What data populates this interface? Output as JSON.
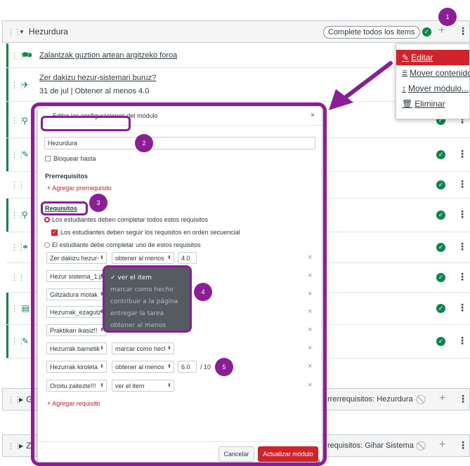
{
  "module": {
    "title": "Hezurdura",
    "completion_badge": "Complete todos los items",
    "items": [
      {
        "title": "Zalantzak guztion artean argitzeko foroa"
      },
      {
        "title": "Zer dakizu hezur-sistemari buruz?",
        "meta": "31 de jul | Obtener al menos 4.0"
      }
    ]
  },
  "context_menu": {
    "items": [
      {
        "label": "Editar",
        "icon": "pencil-icon"
      },
      {
        "label": "Mover contenido",
        "icon": "list-icon"
      },
      {
        "label": "Mover módulo...",
        "icon": "updown-arrow-icon"
      },
      {
        "label": "Eliminar",
        "icon": "trash-icon"
      }
    ]
  },
  "lower_modules": [
    {
      "prefix": "G",
      "prereq": "rrerrequisitos: Hezurdura"
    },
    {
      "prefix": "Z",
      "prereq": "requisitos: Gihar Sistema"
    }
  ],
  "modal": {
    "title": "Editar las configuraciones del módulo",
    "close_label": "×",
    "name_value": "Hezurdura",
    "lock_until_label": "Bloquear hasta",
    "prereq_heading": "Prerrequisitos",
    "add_prereq": "+ Agregar prerrequisito",
    "req_heading": "Requisitos",
    "radio_all": "Los estudiantes deben completar todos estos requisitos",
    "checkbox_sequential": "Los estudiantes deben seguir los requisitos en orden secuencial",
    "radio_one": "El estudiante debe completar uno de estos requisitos",
    "requirements": [
      {
        "item": "Zer dakizu hezur-",
        "type": "obtener al menos",
        "score": "4.0"
      },
      {
        "item": "Hezur sistema_1.p",
        "type": "",
        "score": ""
      },
      {
        "item": "Giltzadura motak",
        "type": "",
        "score": ""
      },
      {
        "item": "Hezurrak_ezagutz",
        "type": "",
        "score": ""
      },
      {
        "item": "Praktikan ikasiz!!",
        "type": "",
        "score": ""
      },
      {
        "item": "Hezurrak barnetik",
        "type": "marcar como hecl",
        "score": ""
      },
      {
        "item": "Hezurrak kiroleta",
        "type": "obtener al menos",
        "score": "6.0",
        "out_of": "/ 10"
      },
      {
        "item": "Oroitu zaitezte!!!",
        "type": "ver el item",
        "score": ""
      }
    ],
    "add_requirement": "+ Agregar requisito",
    "cancel_label": "Cancelar",
    "update_label": "Actualizar módulo",
    "row_remove": "×"
  },
  "dropdown_options": [
    {
      "label": "✓ ver el item",
      "selected": true
    },
    {
      "label": "marcar como hecho",
      "selected": false
    },
    {
      "label": "contribuir a la página",
      "selected": false
    },
    {
      "label": "entregar la tarea",
      "selected": false
    },
    {
      "label": "obtener al menos",
      "selected": false
    }
  ],
  "step_badges": [
    "1",
    "2",
    "3",
    "4",
    "5"
  ],
  "colors": {
    "accent_purple": "#8b1e94",
    "danger_red": "#d0232c",
    "success_green": "#0b874b"
  }
}
